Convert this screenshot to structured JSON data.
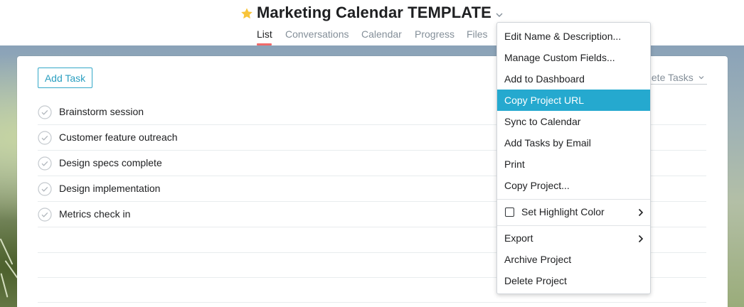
{
  "project": {
    "title": "Marketing Calendar TEMPLATE"
  },
  "tabs": [
    {
      "label": "List"
    },
    {
      "label": "Conversations"
    },
    {
      "label": "Calendar"
    },
    {
      "label": "Progress"
    },
    {
      "label": "Files"
    }
  ],
  "toolbar": {
    "add_task_label": "Add Task",
    "filter_label": "plete Tasks"
  },
  "tasks": [
    {
      "name": "Brainstorm session"
    },
    {
      "name": "Customer feature outreach"
    },
    {
      "name": "Design specs complete"
    },
    {
      "name": "Design implementation"
    },
    {
      "name": "Metrics check in"
    }
  ],
  "menu": {
    "items": [
      {
        "label": "Edit Name & Description..."
      },
      {
        "label": "Manage Custom Fields..."
      },
      {
        "label": "Add to Dashboard"
      },
      {
        "label": "Copy Project URL",
        "highlighted": true
      },
      {
        "label": "Sync to Calendar"
      },
      {
        "label": "Add Tasks by Email"
      },
      {
        "label": "Print"
      },
      {
        "label": "Copy Project..."
      },
      {
        "label": "Set Highlight Color",
        "has_checkbox": true,
        "has_submenu": true
      },
      {
        "label": "Export",
        "has_submenu": true
      },
      {
        "label": "Archive Project"
      },
      {
        "label": "Delete Project"
      }
    ]
  },
  "colors": {
    "accent": "#25a9cf",
    "star": "#f8c43a",
    "tab_active_underline": "#f06a6a",
    "text_primary": "#1e1f21",
    "text_muted": "#848f99"
  },
  "icons": {
    "favorite": "star-icon",
    "title_menu": "chevron-down-icon",
    "task_complete": "check-circle-icon",
    "submenu": "chevron-right-icon"
  }
}
